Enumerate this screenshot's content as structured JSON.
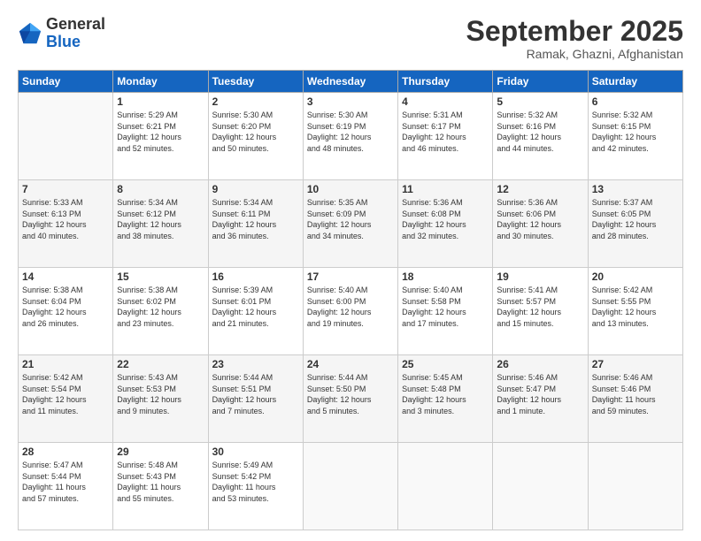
{
  "header": {
    "logo_general": "General",
    "logo_blue": "Blue",
    "month": "September 2025",
    "location": "Ramak, Ghazni, Afghanistan"
  },
  "weekdays": [
    "Sunday",
    "Monday",
    "Tuesday",
    "Wednesday",
    "Thursday",
    "Friday",
    "Saturday"
  ],
  "weeks": [
    [
      {
        "day": null,
        "info": null
      },
      {
        "day": "1",
        "info": "Sunrise: 5:29 AM\nSunset: 6:21 PM\nDaylight: 12 hours\nand 52 minutes."
      },
      {
        "day": "2",
        "info": "Sunrise: 5:30 AM\nSunset: 6:20 PM\nDaylight: 12 hours\nand 50 minutes."
      },
      {
        "day": "3",
        "info": "Sunrise: 5:30 AM\nSunset: 6:19 PM\nDaylight: 12 hours\nand 48 minutes."
      },
      {
        "day": "4",
        "info": "Sunrise: 5:31 AM\nSunset: 6:17 PM\nDaylight: 12 hours\nand 46 minutes."
      },
      {
        "day": "5",
        "info": "Sunrise: 5:32 AM\nSunset: 6:16 PM\nDaylight: 12 hours\nand 44 minutes."
      },
      {
        "day": "6",
        "info": "Sunrise: 5:32 AM\nSunset: 6:15 PM\nDaylight: 12 hours\nand 42 minutes."
      }
    ],
    [
      {
        "day": "7",
        "info": "Sunrise: 5:33 AM\nSunset: 6:13 PM\nDaylight: 12 hours\nand 40 minutes."
      },
      {
        "day": "8",
        "info": "Sunrise: 5:34 AM\nSunset: 6:12 PM\nDaylight: 12 hours\nand 38 minutes."
      },
      {
        "day": "9",
        "info": "Sunrise: 5:34 AM\nSunset: 6:11 PM\nDaylight: 12 hours\nand 36 minutes."
      },
      {
        "day": "10",
        "info": "Sunrise: 5:35 AM\nSunset: 6:09 PM\nDaylight: 12 hours\nand 34 minutes."
      },
      {
        "day": "11",
        "info": "Sunrise: 5:36 AM\nSunset: 6:08 PM\nDaylight: 12 hours\nand 32 minutes."
      },
      {
        "day": "12",
        "info": "Sunrise: 5:36 AM\nSunset: 6:06 PM\nDaylight: 12 hours\nand 30 minutes."
      },
      {
        "day": "13",
        "info": "Sunrise: 5:37 AM\nSunset: 6:05 PM\nDaylight: 12 hours\nand 28 minutes."
      }
    ],
    [
      {
        "day": "14",
        "info": "Sunrise: 5:38 AM\nSunset: 6:04 PM\nDaylight: 12 hours\nand 26 minutes."
      },
      {
        "day": "15",
        "info": "Sunrise: 5:38 AM\nSunset: 6:02 PM\nDaylight: 12 hours\nand 23 minutes."
      },
      {
        "day": "16",
        "info": "Sunrise: 5:39 AM\nSunset: 6:01 PM\nDaylight: 12 hours\nand 21 minutes."
      },
      {
        "day": "17",
        "info": "Sunrise: 5:40 AM\nSunset: 6:00 PM\nDaylight: 12 hours\nand 19 minutes."
      },
      {
        "day": "18",
        "info": "Sunrise: 5:40 AM\nSunset: 5:58 PM\nDaylight: 12 hours\nand 17 minutes."
      },
      {
        "day": "19",
        "info": "Sunrise: 5:41 AM\nSunset: 5:57 PM\nDaylight: 12 hours\nand 15 minutes."
      },
      {
        "day": "20",
        "info": "Sunrise: 5:42 AM\nSunset: 5:55 PM\nDaylight: 12 hours\nand 13 minutes."
      }
    ],
    [
      {
        "day": "21",
        "info": "Sunrise: 5:42 AM\nSunset: 5:54 PM\nDaylight: 12 hours\nand 11 minutes."
      },
      {
        "day": "22",
        "info": "Sunrise: 5:43 AM\nSunset: 5:53 PM\nDaylight: 12 hours\nand 9 minutes."
      },
      {
        "day": "23",
        "info": "Sunrise: 5:44 AM\nSunset: 5:51 PM\nDaylight: 12 hours\nand 7 minutes."
      },
      {
        "day": "24",
        "info": "Sunrise: 5:44 AM\nSunset: 5:50 PM\nDaylight: 12 hours\nand 5 minutes."
      },
      {
        "day": "25",
        "info": "Sunrise: 5:45 AM\nSunset: 5:48 PM\nDaylight: 12 hours\nand 3 minutes."
      },
      {
        "day": "26",
        "info": "Sunrise: 5:46 AM\nSunset: 5:47 PM\nDaylight: 12 hours\nand 1 minute."
      },
      {
        "day": "27",
        "info": "Sunrise: 5:46 AM\nSunset: 5:46 PM\nDaylight: 11 hours\nand 59 minutes."
      }
    ],
    [
      {
        "day": "28",
        "info": "Sunrise: 5:47 AM\nSunset: 5:44 PM\nDaylight: 11 hours\nand 57 minutes."
      },
      {
        "day": "29",
        "info": "Sunrise: 5:48 AM\nSunset: 5:43 PM\nDaylight: 11 hours\nand 55 minutes."
      },
      {
        "day": "30",
        "info": "Sunrise: 5:49 AM\nSunset: 5:42 PM\nDaylight: 11 hours\nand 53 minutes."
      },
      {
        "day": null,
        "info": null
      },
      {
        "day": null,
        "info": null
      },
      {
        "day": null,
        "info": null
      },
      {
        "day": null,
        "info": null
      }
    ]
  ]
}
